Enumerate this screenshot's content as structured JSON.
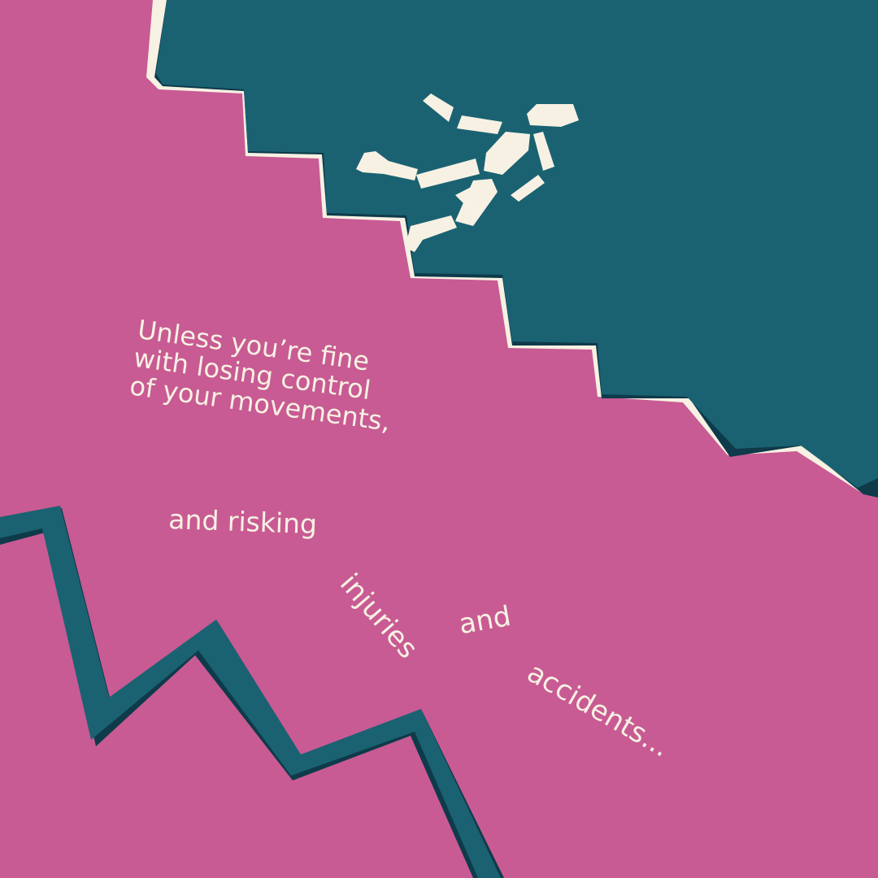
{
  "colors": {
    "background": "#c85b93",
    "stairs": "#1a6272",
    "shadow": "#0e3a4a",
    "cream": "#f7f1e3"
  },
  "icons": {
    "figure": "falling-person-icon",
    "stairs": "staircase-shape",
    "zigzag": "zigzag-line-shape"
  },
  "headline": {
    "line1": "Unless you’re fine",
    "line2": "with losing control",
    "line3": "of your movements,"
  },
  "phrase_risking": "and risking",
  "word_injuries": "injuries",
  "word_and": "and",
  "word_accidents": "accidents..."
}
